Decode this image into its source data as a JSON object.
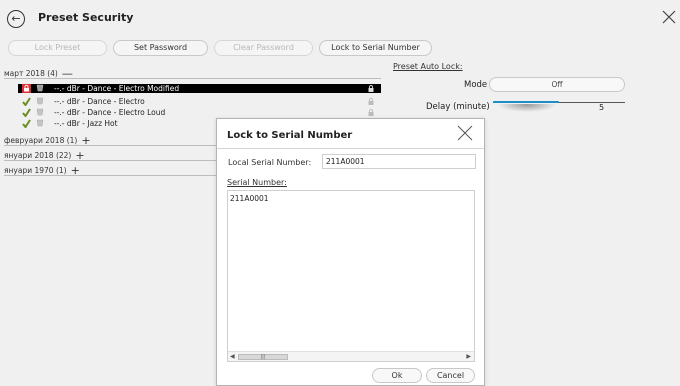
{
  "window": {
    "title": "Preset Security"
  },
  "toolbar": {
    "lock_preset": "Lock Preset",
    "set_password": "Set Password",
    "clear_password": "Clear Password",
    "lock_to_serial": "Lock to Serial Number"
  },
  "groups": [
    {
      "label": "март 2018 (4)",
      "sign": "—"
    },
    {
      "label": "февруари 2018 (1)",
      "sign": "+"
    },
    {
      "label": "януари 2018 (22)",
      "sign": "+"
    },
    {
      "label": "януари 1970 (1)",
      "sign": "+"
    }
  ],
  "presets": [
    {
      "name": "--.- dBr -  Dance - Electro Modified",
      "selected": true
    },
    {
      "name": "--.- dBr -  Dance - Electro"
    },
    {
      "name": "--.- dBr -  Dance - Electro Loud"
    },
    {
      "name": "--.- dBr -  Jazz Hot"
    }
  ],
  "auto_lock": {
    "section_title": "Preset Auto Lock:",
    "mode_label": "Mode",
    "mode_value": "Off",
    "delay_label": "Delay (minute)",
    "delay_value": "5"
  },
  "dialog": {
    "title": "Lock to Serial Number",
    "local_serial_label": "Local Serial Number:",
    "local_serial_value": "211A0001",
    "serial_label": "Serial Number:",
    "serial_value": "211A0001",
    "ok": "Ok",
    "cancel": "Cancel"
  },
  "colors": {
    "accent": "#1d8fc4",
    "selected_row": "#000000",
    "lock_icon_red": "#e03030"
  },
  "icons": [
    "back-arrow-icon",
    "close-icon",
    "padlock-icon",
    "preset-shield-icon",
    "preset-check-icon"
  ]
}
